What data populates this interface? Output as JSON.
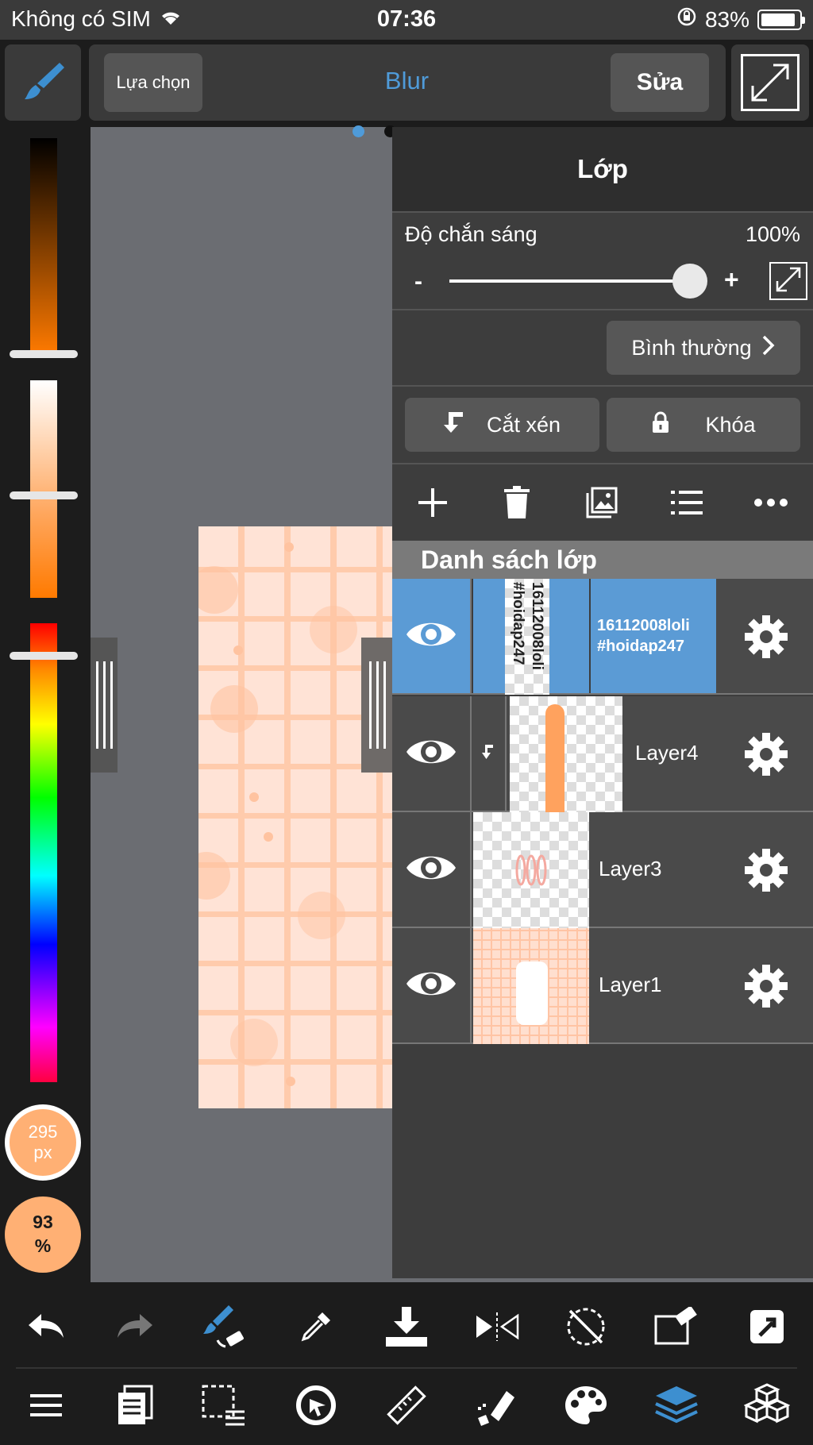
{
  "status_bar": {
    "carrier": "Không có SIM",
    "time": "07:36",
    "battery": "83%",
    "battery_level": 0.83
  },
  "toolbar": {
    "select_label": "Lựa chọn",
    "title": "Blur",
    "edit_label": "Sửa"
  },
  "brush": {
    "size": "295",
    "size_unit": "px",
    "opacity": "93",
    "opacity_unit": "%"
  },
  "layers_panel": {
    "title": "Lớp",
    "opacity_label": "Độ chắn sáng",
    "opacity_value": "100%",
    "opacity_level": 1.0,
    "minus": "-",
    "plus": "+",
    "blend_mode": "Bình thường",
    "clip_label": "Cắt xén",
    "lock_label": "Khóa",
    "list_header": "Danh sách lớp",
    "layers": [
      {
        "name": "16112008loli\n#hoidap247",
        "thumb_text": "16112008loli\n#hoidap247",
        "selected": true
      },
      {
        "name": "Layer4",
        "clipped": true
      },
      {
        "name": "Layer3"
      },
      {
        "name": "Layer1"
      }
    ]
  },
  "icons": {
    "brush": "paintbrush-icon",
    "expand": "expand-icon",
    "add_layer": "plus-icon",
    "delete_layer": "trash-icon",
    "image_layer": "image-icon",
    "list": "list-icon",
    "more": "more-icon",
    "eye": "eye-icon",
    "gear": "gear-icon",
    "undo": "undo-icon",
    "redo": "redo-icon",
    "brush_eraser": "brush-eraser-icon",
    "eyedropper": "eyedropper-icon",
    "save": "download-icon",
    "flip": "flip-icon",
    "rotate": "rotate-icon",
    "transform": "transform-icon",
    "share": "share-icon",
    "menu": "menu-icon",
    "pages": "pages-icon",
    "selection": "selection-icon",
    "snap": "snap-icon",
    "ruler": "ruler-icon",
    "fill": "fill-icon",
    "palette": "palette-icon",
    "layers": "layers-icon",
    "materials": "materials-icon"
  },
  "colors": {
    "accent": "#4f9bd9",
    "selected_row": "#5b9bd5",
    "brush_color": "#ffb074"
  }
}
